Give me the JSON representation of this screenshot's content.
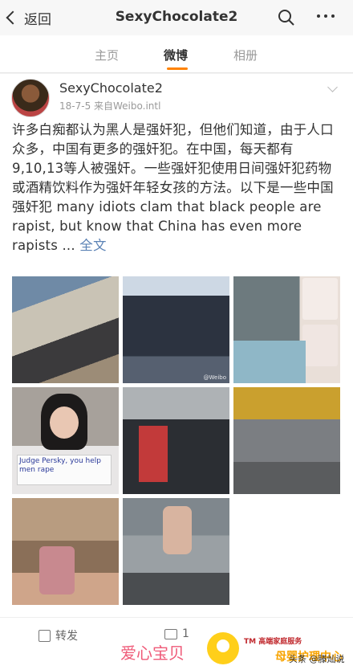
{
  "nav": {
    "back_label": "返回",
    "title": "SexyChocolate2"
  },
  "tabs": [
    {
      "label": "主页",
      "active": false
    },
    {
      "label": "微博",
      "active": true
    },
    {
      "label": "相册",
      "active": false
    }
  ],
  "post": {
    "username": "SexyChocolate2",
    "meta": "18-7-5  来自Weibo.intl",
    "text": "许多白痴都认为黑人是强奸犯，但他们知道，由于人口众多，中国有更多的强奸犯。在中国，每天都有9,10,13等人被强奸。一些强奸犯使用日间强奸犯药物或酒精饮料作为强奸年轻女孩的方法。以下是一些中国强奸犯 many idiots clam that black people are rapist, but know that China has even more rapists ... ",
    "full_text_link": "全文",
    "photo_watermark": "@Weibo",
    "sign_text": "Judge Persky, you help men rape"
  },
  "actions": {
    "repost_label": "转发",
    "comment_count": "1"
  },
  "banner": {
    "brand_left": "爱心宝贝",
    "tm_text": "TM 高端家庭服务",
    "brand_right": "母婴护理中心",
    "source": "头条 @滕灿说"
  },
  "colors": {
    "accent": "#ff8200",
    "link": "#5b82b5",
    "brand_pink": "#ef5a78"
  }
}
